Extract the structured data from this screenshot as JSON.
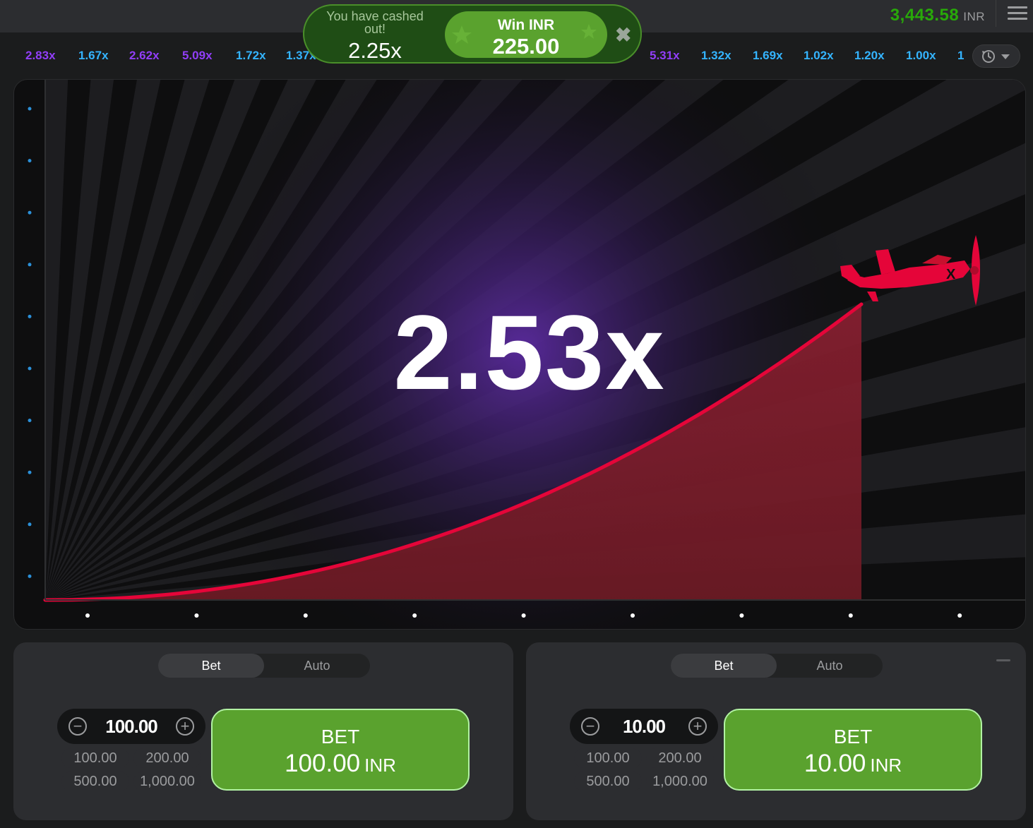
{
  "header": {
    "balance": "3,443.58",
    "currency": "INR",
    "menu_icon": "hamburger-icon"
  },
  "history": {
    "items": [
      {
        "value": "2.83x",
        "color": "#913ef8"
      },
      {
        "value": "1.67x",
        "color": "#34b4ff"
      },
      {
        "value": "2.62x",
        "color": "#913ef8"
      },
      {
        "value": "5.09x",
        "color": "#913ef8"
      },
      {
        "value": "1.72x",
        "color": "#34b4ff"
      },
      {
        "value": "1.37x",
        "color": "#34b4ff"
      },
      {
        "value": "5.31x",
        "color": "#913ef8"
      },
      {
        "value": "1.32x",
        "color": "#34b4ff"
      },
      {
        "value": "1.69x",
        "color": "#34b4ff"
      },
      {
        "value": "1.02x",
        "color": "#34b4ff"
      },
      {
        "value": "1.20x",
        "color": "#34b4ff"
      },
      {
        "value": "1.00x",
        "color": "#34b4ff"
      },
      {
        "value": "1",
        "color": "#34b4ff"
      }
    ],
    "more_icon": "history-icon"
  },
  "cashout": {
    "text": "You have cashed out!",
    "multiplier": "2.25x",
    "win_label": "Win INR",
    "win_amount": "225.00",
    "close_icon": "close-icon"
  },
  "game": {
    "multiplier": "2.53x",
    "plane_icon": "airplane-icon",
    "plane_label": "X",
    "colors": {
      "curve": "#e50539",
      "area": "#6b1a24",
      "glow": "#5a2a9e"
    }
  },
  "panels": [
    {
      "tabs": [
        "Bet",
        "Auto"
      ],
      "amount": "100.00",
      "quick": [
        "100.00",
        "200.00",
        "500.00",
        "1,000.00"
      ],
      "bet_label": "BET",
      "bet_amount": "100.00",
      "bet_currency": "INR"
    },
    {
      "tabs": [
        "Bet",
        "Auto"
      ],
      "amount": "10.00",
      "quick": [
        "100.00",
        "200.00",
        "500.00",
        "1,000.00"
      ],
      "bet_label": "BET",
      "bet_amount": "10.00",
      "bet_currency": "INR"
    }
  ]
}
